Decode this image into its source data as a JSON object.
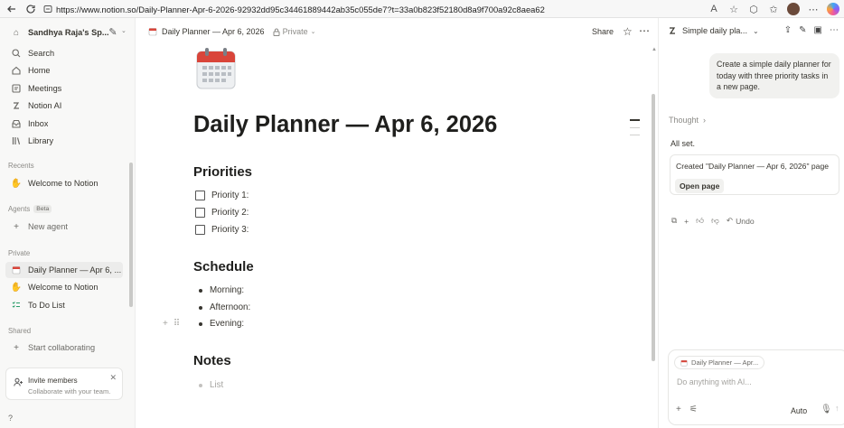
{
  "browser": {
    "url": "https://www.notion.so/Daily-Planner-Apr-6-2026-92932dd95c34461889442ab35c055de7?t=33a0b823f52180d8a9f700a92c8aea62",
    "reader_label": "A"
  },
  "sidebar": {
    "workspace": "Sandhya Raja's Sp...",
    "items": [
      {
        "label": "Search",
        "icon": "search-icon"
      },
      {
        "label": "Home",
        "icon": "home-icon"
      },
      {
        "label": "Meetings",
        "icon": "meetings-icon"
      },
      {
        "label": "Notion AI",
        "icon": "notion-ai-icon"
      },
      {
        "label": "Inbox",
        "icon": "inbox-icon"
      },
      {
        "label": "Library",
        "icon": "library-icon"
      }
    ],
    "recents_header": "Recents",
    "recents": [
      {
        "label": "Welcome to Notion"
      }
    ],
    "agents_header": "Agents",
    "agents_badge": "Beta",
    "new_agent": "New agent",
    "private_header": "Private",
    "private": [
      {
        "label": "Daily Planner — Apr 6, ..."
      },
      {
        "label": "Welcome to Notion"
      },
      {
        "label": "To Do List"
      }
    ],
    "shared_header": "Shared",
    "start_collaborating": "Start collaborating",
    "invite_title": "Invite members",
    "invite_sub": "Collaborate with your team."
  },
  "topbar": {
    "breadcrumb": "Daily Planner — Apr 6, 2026",
    "privacy": "Private",
    "share": "Share"
  },
  "doc": {
    "title": "Daily Planner — Apr 6, 2026",
    "priorities_heading": "Priorities",
    "priorities": [
      "Priority 1:",
      "Priority 2:",
      "Priority 3:"
    ],
    "schedule_heading": "Schedule",
    "schedule": [
      "Morning:",
      "Afternoon:",
      "Evening:"
    ],
    "notes_heading": "Notes",
    "notes_placeholder": "List"
  },
  "ai_panel": {
    "title": "Simple daily pla...",
    "user_message": "Create a simple daily planner for today with three priority tasks in a new page.",
    "thought": "Thought",
    "reply": "All set.",
    "created": "Created \"Daily Planner — Apr 6, 2026\" page",
    "open_page": "Open page",
    "undo": "Undo",
    "context_chip": "Daily Planner — Apr...",
    "input_placeholder": "Do anything with AI...",
    "mode": "Auto"
  }
}
